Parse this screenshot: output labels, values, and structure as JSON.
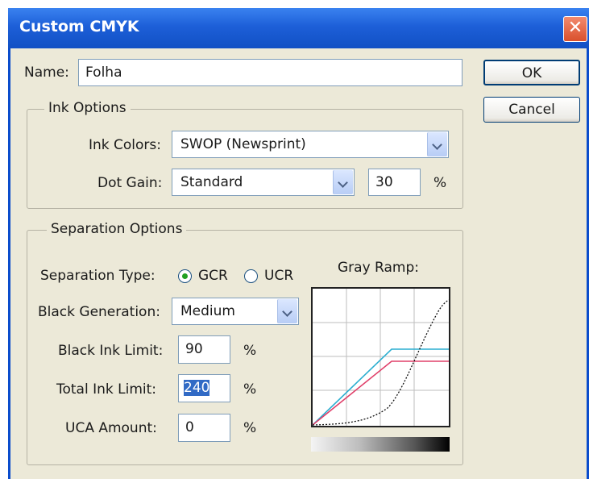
{
  "window": {
    "title": "Custom CMYK",
    "close_glyph": "✕"
  },
  "name_field": {
    "label": "Name:",
    "value": "Folha"
  },
  "buttons": {
    "ok": "OK",
    "cancel": "Cancel"
  },
  "ink_options": {
    "group_label": "Ink Options",
    "ink_colors": {
      "label": "Ink Colors:",
      "value": "SWOP (Newsprint)"
    },
    "dot_gain": {
      "label": "Dot Gain:",
      "value": "Standard",
      "amount": "30",
      "unit": "%"
    }
  },
  "separation_options": {
    "group_label": "Separation Options",
    "separation_type": {
      "label": "Separation Type:",
      "options": [
        "GCR",
        "UCR"
      ],
      "selected": "GCR"
    },
    "black_generation": {
      "label": "Black Generation:",
      "value": "Medium"
    },
    "black_ink_limit": {
      "label": "Black Ink Limit:",
      "value": "90",
      "unit": "%"
    },
    "total_ink_limit": {
      "label": "Total Ink Limit:",
      "value": "240",
      "unit": "%"
    },
    "uca_amount": {
      "label": "UCA Amount:",
      "value": "0",
      "unit": "%"
    },
    "gray_ramp": {
      "label": "Gray Ramp:"
    }
  },
  "colors": {
    "cyan_curve": "#2aaed0",
    "magenta_curve": "#e0406a",
    "black_curve": "#111111",
    "title_blue": "#1d5fd8"
  }
}
